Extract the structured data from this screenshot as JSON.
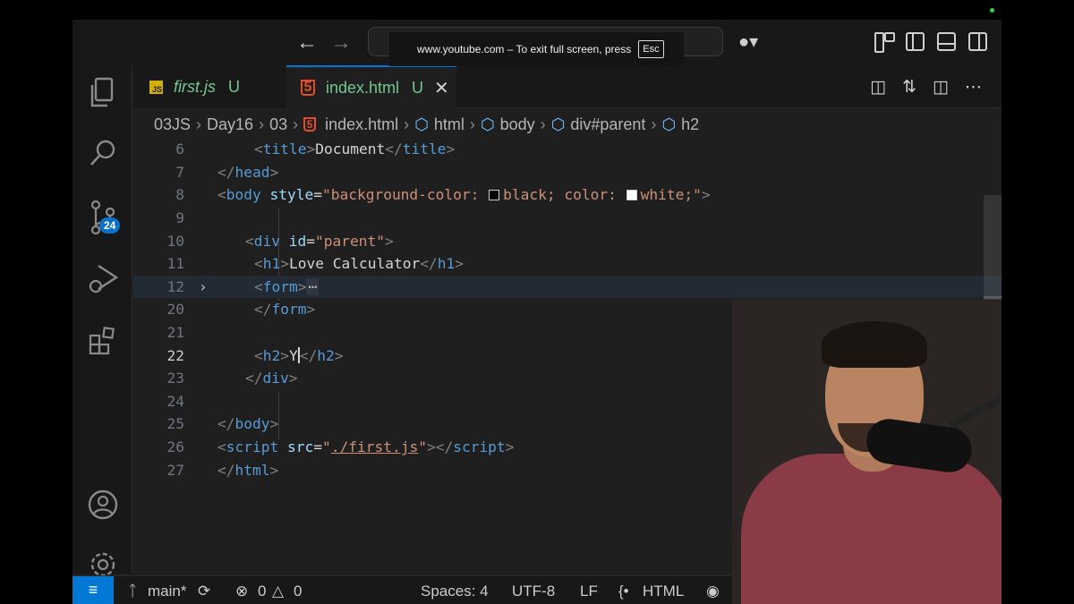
{
  "browser_overlay": {
    "message": "www.youtube.com – To exit full screen, press",
    "key": "Esc"
  },
  "titlebar": {
    "back_icon": "arrow-left-icon",
    "forward_icon": "arrow-right-icon"
  },
  "activity_bar": {
    "items": [
      {
        "name": "explorer",
        "icon": "files-icon"
      },
      {
        "name": "search",
        "icon": "search-icon"
      },
      {
        "name": "source-control",
        "icon": "source-control-icon",
        "badge": "24"
      },
      {
        "name": "run-debug",
        "icon": "run-debug-icon"
      },
      {
        "name": "extensions",
        "icon": "extensions-icon"
      }
    ],
    "bottom": [
      {
        "name": "accounts",
        "icon": "account-icon"
      },
      {
        "name": "manage",
        "icon": "gear-icon"
      }
    ]
  },
  "tabs": [
    {
      "label": "first.js",
      "status": "U",
      "icon": "JS",
      "active": false
    },
    {
      "label": "index.html",
      "status": "U",
      "icon": "5",
      "active": true
    }
  ],
  "breadcrumb": [
    "03JS",
    "Day16",
    "03",
    "index.html",
    "html",
    "body",
    "div#parent",
    "h2"
  ],
  "code_lines": [
    {
      "n": "6"
    },
    {
      "n": "7"
    },
    {
      "n": "8"
    },
    {
      "n": "9"
    },
    {
      "n": "10"
    },
    {
      "n": "11"
    },
    {
      "n": "12"
    },
    {
      "n": "20"
    },
    {
      "n": "21"
    },
    {
      "n": "22"
    },
    {
      "n": "23"
    },
    {
      "n": "24"
    },
    {
      "n": "25"
    },
    {
      "n": "26"
    },
    {
      "n": "27"
    }
  ],
  "code": {
    "title_text": "Document",
    "body_style_prefix": "background-color: ",
    "body_style_black": "black",
    "body_style_mid": "; color: ",
    "body_style_white": "white",
    "body_style_end": ";",
    "div_id": "parent",
    "h1_text": "Love Calculator",
    "h2_text": "Y",
    "script_src": "./first.js"
  },
  "statusbar": {
    "branch": "main*",
    "errors": "0",
    "warnings": "0",
    "spaces": "Spaces: 4",
    "encoding": "UTF-8",
    "eol": "LF",
    "language": "HTML"
  }
}
